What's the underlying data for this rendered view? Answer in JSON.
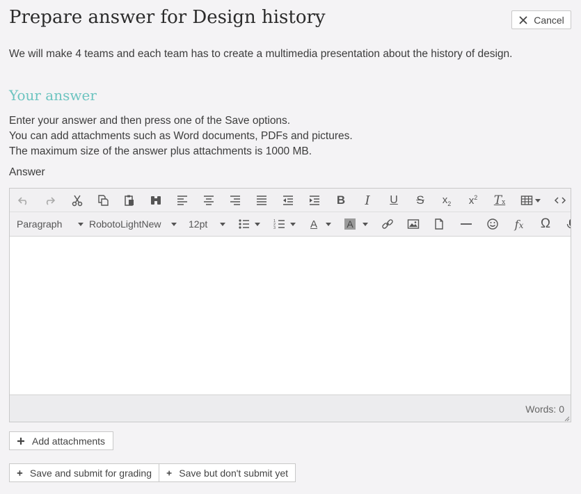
{
  "header": {
    "title": "Prepare answer for Design history",
    "cancel_label": "Cancel"
  },
  "description": "We will make 4 teams and each team has to create a multimedia presentation about the history of design.",
  "section": {
    "heading": "Your answer",
    "instructions": [
      "Enter your answer and then press one of the Save options.",
      "You can add attachments such as Word documents, PDFs and pictures.",
      "The maximum size of the answer plus attachments is 1000 MB."
    ],
    "answer_label": "Answer"
  },
  "editor": {
    "block_format": "Paragraph",
    "font_family": "RobotoLightNew",
    "font_size": "12pt",
    "word_count": "Words: 0",
    "content": "",
    "row1_icons": [
      "undo-icon",
      "redo-icon",
      "cut-icon",
      "copy-icon",
      "paste-icon",
      "find-replace-icon",
      "align-left-icon",
      "align-center-icon",
      "align-right-icon",
      "align-justify-icon",
      "outdent-icon",
      "indent-icon",
      "bold-icon",
      "italic-icon",
      "underline-icon",
      "strikethrough-icon",
      "subscript-icon",
      "superscript-icon",
      "clear-formatting-icon",
      "table-icon",
      "source-code-icon"
    ],
    "row2_icons": [
      "bullet-list-icon",
      "numbered-list-icon",
      "text-color-icon",
      "background-color-icon",
      "link-icon",
      "image-icon",
      "document-icon",
      "horizontal-rule-icon",
      "emoticon-icon",
      "formula-icon",
      "special-character-icon",
      "microphone-icon"
    ]
  },
  "actions": {
    "add_attachments": "Add attachments",
    "save_and_submit": "Save and submit for grading",
    "save_no_submit": "Save but don't submit yet"
  },
  "colors": {
    "accent_heading": "#6dc4c0",
    "background": "#f4f3f5",
    "toolbar": "#f1f0f2"
  }
}
